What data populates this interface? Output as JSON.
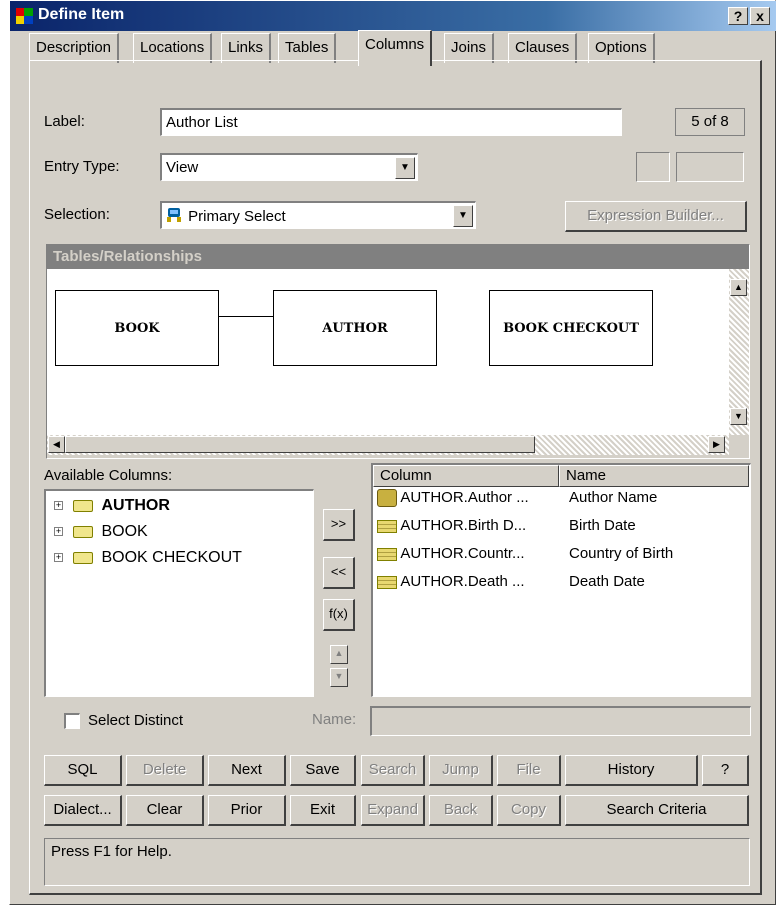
{
  "window": {
    "title": "Define Item",
    "help_glyph": "?",
    "close_glyph": "x"
  },
  "tabs": [
    "Description",
    "Locations",
    "Links",
    "Tables",
    "Columns",
    "Joins",
    "Clauses",
    "Options"
  ],
  "active_tab": "Columns",
  "form": {
    "label_caption": "Label:",
    "label_value": "Author List",
    "record_counter": "5 of 8",
    "entry_type_caption": "Entry Type:",
    "entry_type_value": "View",
    "selection_caption": "Selection:",
    "selection_value": "Primary Select",
    "expression_builder": "Expression Builder..."
  },
  "diagram": {
    "header": "Tables/Relationships",
    "entities": [
      "BOOK",
      "AUTHOR",
      "BOOK CHECKOUT"
    ]
  },
  "available_columns": {
    "caption": "Available Columns:",
    "items": [
      {
        "label": "AUTHOR",
        "bold": true
      },
      {
        "label": "BOOK",
        "bold": false
      },
      {
        "label": "BOOK CHECKOUT",
        "bold": false
      }
    ]
  },
  "move_buttons": {
    "add": ">>",
    "remove": "<<",
    "function": "f(x)"
  },
  "selected_columns": {
    "headers": [
      "Column",
      "Name"
    ],
    "rows": [
      {
        "column": "AUTHOR.Author ...",
        "name": "Author Name",
        "icon": "key-icon"
      },
      {
        "column": "AUTHOR.Birth D...",
        "name": "Birth Date",
        "icon": "field-icon"
      },
      {
        "column": "AUTHOR.Countr...",
        "name": "Country of Birth",
        "icon": "field-icon"
      },
      {
        "column": "AUTHOR.Death ...",
        "name": "Death Date",
        "icon": "field-icon"
      }
    ]
  },
  "select_distinct": {
    "label": "Select Distinct",
    "checked": false
  },
  "name_caption": "Name:",
  "buttons_row1": [
    {
      "label": "SQL",
      "enabled": true
    },
    {
      "label": "Delete",
      "enabled": false
    },
    {
      "label": "Next",
      "enabled": true
    },
    {
      "label": "Save",
      "enabled": true
    },
    {
      "label": "Search",
      "enabled": false
    },
    {
      "label": "Jump",
      "enabled": false
    },
    {
      "label": "File",
      "enabled": false
    },
    {
      "label": "History",
      "enabled": true
    },
    {
      "label": "?",
      "enabled": true
    }
  ],
  "buttons_row2": [
    {
      "label": "Dialect...",
      "enabled": true
    },
    {
      "label": "Clear",
      "enabled": true
    },
    {
      "label": "Prior",
      "enabled": true
    },
    {
      "label": "Exit",
      "enabled": true
    },
    {
      "label": "Expand",
      "enabled": false
    },
    {
      "label": "Back",
      "enabled": false
    },
    {
      "label": "Copy",
      "enabled": false
    },
    {
      "label": "Search Criteria",
      "enabled": true
    }
  ],
  "status": "Press F1 for Help.",
  "colors": {
    "face": "#d4d0c8",
    "title_start": "#0a246a",
    "title_end": "#a6caf0",
    "group_header": "#808080"
  }
}
